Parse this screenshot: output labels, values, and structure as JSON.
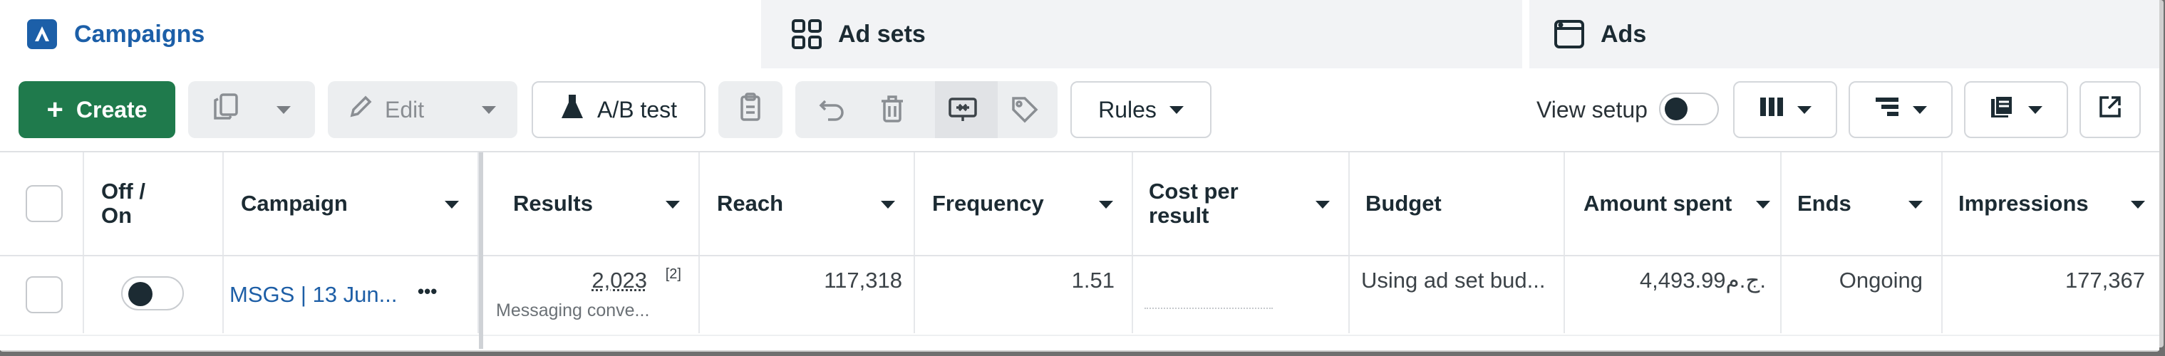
{
  "tabs": {
    "campaigns": "Campaigns",
    "ad_sets": "Ad sets",
    "ads": "Ads"
  },
  "toolbar": {
    "create": "Create",
    "edit": "Edit",
    "ab_test": "A/B test",
    "rules": "Rules",
    "view_setup": "View setup",
    "view_setup_on": false
  },
  "table": {
    "headers": {
      "off_on": "Off /\nOn",
      "campaign": "Campaign",
      "results": "Results",
      "reach": "Reach",
      "frequency": "Frequency",
      "cost_per_result": "Cost per\nresult",
      "budget": "Budget",
      "amount_spent": "Amount spent",
      "ends": "Ends",
      "impressions": "Impressions"
    },
    "rows": [
      {
        "campaign": "MSGS | 13 Jun...",
        "more": "•••",
        "results": "2,023",
        "results_note": "[2]",
        "results_type": "Messaging conve...",
        "reach": "117,318",
        "frequency": "1.51",
        "budget": "Using ad set bud...",
        "amount_spent": "4,493.99ج.م.",
        "ends": "Ongoing",
        "impressions": "177,367"
      }
    ]
  },
  "colors": {
    "create_green": "#1f7a4c",
    "link_blue": "#1d5ea6",
    "active_tab": "#1c5fa8"
  }
}
